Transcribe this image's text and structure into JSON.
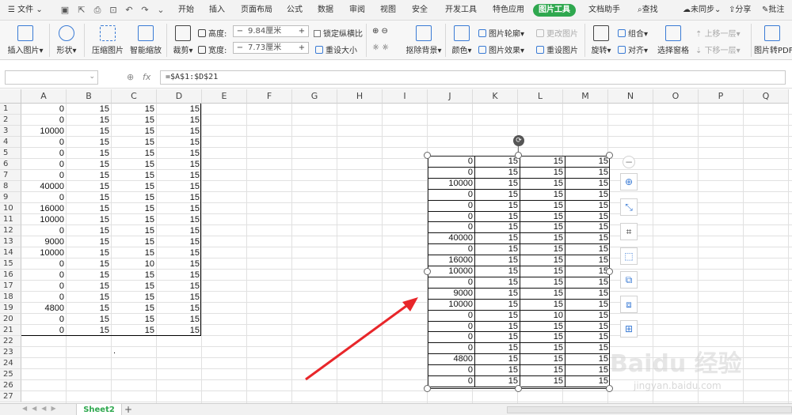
{
  "menubar": {
    "file_label": "文件",
    "tabs": [
      "开始",
      "插入",
      "页面布局",
      "公式",
      "数据",
      "审阅",
      "视图",
      "安全",
      "开发工具",
      "特色应用",
      "图片工具",
      "文档助手"
    ],
    "active_tab": "图片工具",
    "search_label": "查找",
    "sync_label": "未同步",
    "share_label": "分享",
    "comment_label": "批注"
  },
  "ribbon": {
    "insert_picture": "插入图片",
    "shape": "形状",
    "compress": "压缩图片",
    "smart_zoom": "智能缩放",
    "crop": "裁剪",
    "height_label": "高度:",
    "height_value": "9.84厘米",
    "width_label": "宽度:",
    "width_value": "7.73厘米",
    "lock_ratio": "锁定纵横比",
    "reset_size": "重设大小",
    "remove_bg": "抠除背景",
    "color": "颜色",
    "outline": "图片轮廓",
    "effect": "图片效果",
    "change_pic": "更改图片",
    "reset_pic": "重设图片",
    "rotate": "旋转",
    "group": "组合",
    "align": "对齐",
    "select_pane": "选择窗格",
    "bring_forward": "上移一层",
    "send_backward": "下移一层",
    "pic_to_pdf": "图片转PDF"
  },
  "formula_bar": {
    "name_box": "",
    "fx": "fx",
    "formula": "=$A$1:$D$21"
  },
  "columns": [
    "A",
    "B",
    "C",
    "D",
    "E",
    "F",
    "G",
    "H",
    "I",
    "J",
    "K",
    "L",
    "M",
    "N",
    "O",
    "P",
    "Q"
  ],
  "rows": [
    "1",
    "2",
    "3",
    "4",
    "5",
    "6",
    "7",
    "8",
    "9",
    "10",
    "11",
    "12",
    "13",
    "14",
    "15",
    "16",
    "17",
    "18",
    "19",
    "20",
    "21",
    "22",
    "23",
    "24",
    "25",
    "26",
    "27"
  ],
  "table": [
    [
      "0",
      "15",
      "15",
      "15"
    ],
    [
      "0",
      "15",
      "15",
      "15"
    ],
    [
      "10000",
      "15",
      "15",
      "15"
    ],
    [
      "0",
      "15",
      "15",
      "15"
    ],
    [
      "0",
      "15",
      "15",
      "15"
    ],
    [
      "0",
      "15",
      "15",
      "15"
    ],
    [
      "0",
      "15",
      "15",
      "15"
    ],
    [
      "40000",
      "15",
      "15",
      "15"
    ],
    [
      "0",
      "15",
      "15",
      "15"
    ],
    [
      "16000",
      "15",
      "15",
      "15"
    ],
    [
      "10000",
      "15",
      "15",
      "15"
    ],
    [
      "0",
      "15",
      "15",
      "15"
    ],
    [
      "9000",
      "15",
      "15",
      "15"
    ],
    [
      "10000",
      "15",
      "15",
      "15"
    ],
    [
      "0",
      "15",
      "10",
      "15"
    ],
    [
      "0",
      "15",
      "15",
      "15"
    ],
    [
      "0",
      "15",
      "15",
      "15"
    ],
    [
      "0",
      "15",
      "15",
      "15"
    ],
    [
      "4800",
      "15",
      "15",
      "15"
    ],
    [
      "0",
      "15",
      "15",
      "15"
    ],
    [
      "0",
      "15",
      "15",
      "15"
    ]
  ],
  "stray_mark": ".",
  "sheet_tabs": {
    "active": "Sheet2",
    "add": "+"
  },
  "watermark": {
    "main": "Baidu 经验",
    "sub": "jingyan.baidu.com"
  },
  "arrow_color": "#e8262a",
  "accent_color": "#2fa84f"
}
